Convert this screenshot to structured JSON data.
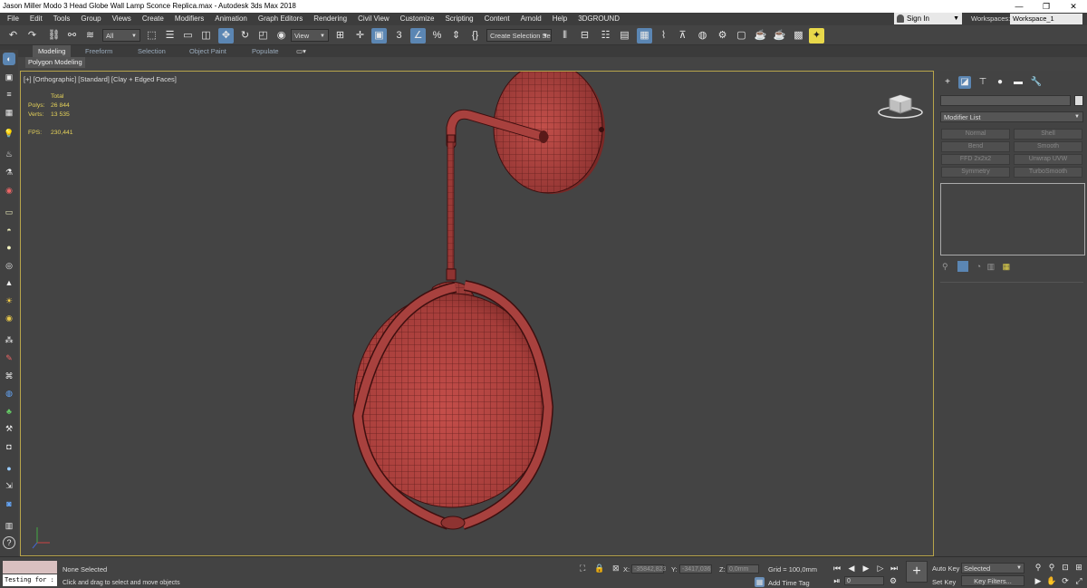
{
  "window": {
    "title": "Jason Miller Modo 3 Head Globe Wall Lamp Sconce Replica.max - Autodesk 3ds Max 2018",
    "minimize": "—",
    "maximize": "❐",
    "close": "✕"
  },
  "menu": [
    "File",
    "Edit",
    "Tools",
    "Group",
    "Views",
    "Create",
    "Modifiers",
    "Animation",
    "Graph Editors",
    "Rendering",
    "Civil View",
    "Customize",
    "Scripting",
    "Content",
    "Arnold",
    "Help",
    "3DGROUND"
  ],
  "account": {
    "sign_in": "Sign In",
    "workspaces_label": "Workspaces:",
    "workspace_value": "Workspace_1"
  },
  "toolbar": {
    "filter_dropdown": "All",
    "ref_coord_dropdown": "View",
    "selection_set": "Create Selection Se",
    "snap_label": "3"
  },
  "ribbon": {
    "tabs": [
      "Modeling",
      "Freeform",
      "Selection",
      "Object Paint",
      "Populate"
    ],
    "active_tab": "Modeling",
    "panel": "Polygon Modeling"
  },
  "viewport": {
    "label": "[+] [Orthographic] [Standard] [Clay + Edged Faces]",
    "stats_header": "Total",
    "polys_label": "Polys:",
    "polys_value": "26 844",
    "verts_label": "Verts:",
    "verts_value": "13 535",
    "fps_label": "FPS:",
    "fps_value": "230,441",
    "model_color": "#a9403d"
  },
  "command_panel": {
    "modifier_list": "Modifier List",
    "modifiers": [
      "Normal",
      "Shell",
      "Bend",
      "Smooth",
      "FFD 2x2x2",
      "Unwrap UVW",
      "Symmetry",
      "TurboSmooth"
    ]
  },
  "status": {
    "script_text": "Testing for :",
    "selection": "None Selected",
    "prompt": "Click and drag to select and move objects",
    "x_label": "X:",
    "x_value": "-35842,823",
    "y_label": "Y:",
    "y_value": "-3417,036",
    "z_label": "Z:",
    "z_value": "0,0mm",
    "grid": "Grid = 100,0mm",
    "add_time_tag": "Add Time Tag",
    "auto_key": "Auto Key",
    "set_key": "Set Key",
    "key_mode": "Selected",
    "key_filters": "Key Filters...",
    "frame": "0"
  }
}
